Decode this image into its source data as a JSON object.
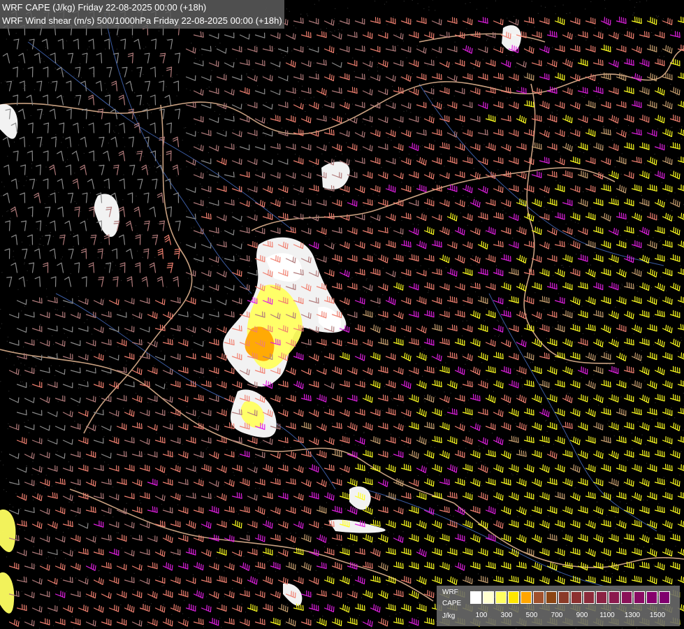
{
  "titles": {
    "line1": "WRF CAPE (J/kg) Friday 22-08-2025 00:00 (+18h)",
    "line2": "WRF Wind shear (m/s) 500/1000hPa Friday 22-08-2025 00:00 (+18h)"
  },
  "legend": {
    "label_top": "WRF",
    "label_mid": "CAPE",
    "label_unit": "J/kg",
    "ticks": [
      "100",
      "300",
      "500",
      "700",
      "900",
      "1100",
      "1300",
      "1500"
    ],
    "colors": [
      "#ffffff",
      "#ffffd0",
      "#ffff60",
      "#ffe600",
      "#ffa500",
      "#a0522d",
      "#8b4513",
      "#8a3a28",
      "#8c3030",
      "#8b2a3a",
      "#8b2244",
      "#8b1a4e",
      "#8a1258",
      "#880a62",
      "#86006c",
      "#80006e"
    ]
  },
  "barb_colors": {
    "weak": "#8a8a8a",
    "light": "#b07a7a",
    "moderate": "#f08070",
    "strong": "#e020e0",
    "very_strong": "#ffff20",
    "tan": "#c8a070"
  },
  "map_colors": {
    "background": "#000000",
    "borders": "#c8a080",
    "rivers": "#3a5aa0",
    "cape_low": "#ffffff",
    "cape_mid": "#ffff60",
    "cape_high": "#ffa500"
  }
}
